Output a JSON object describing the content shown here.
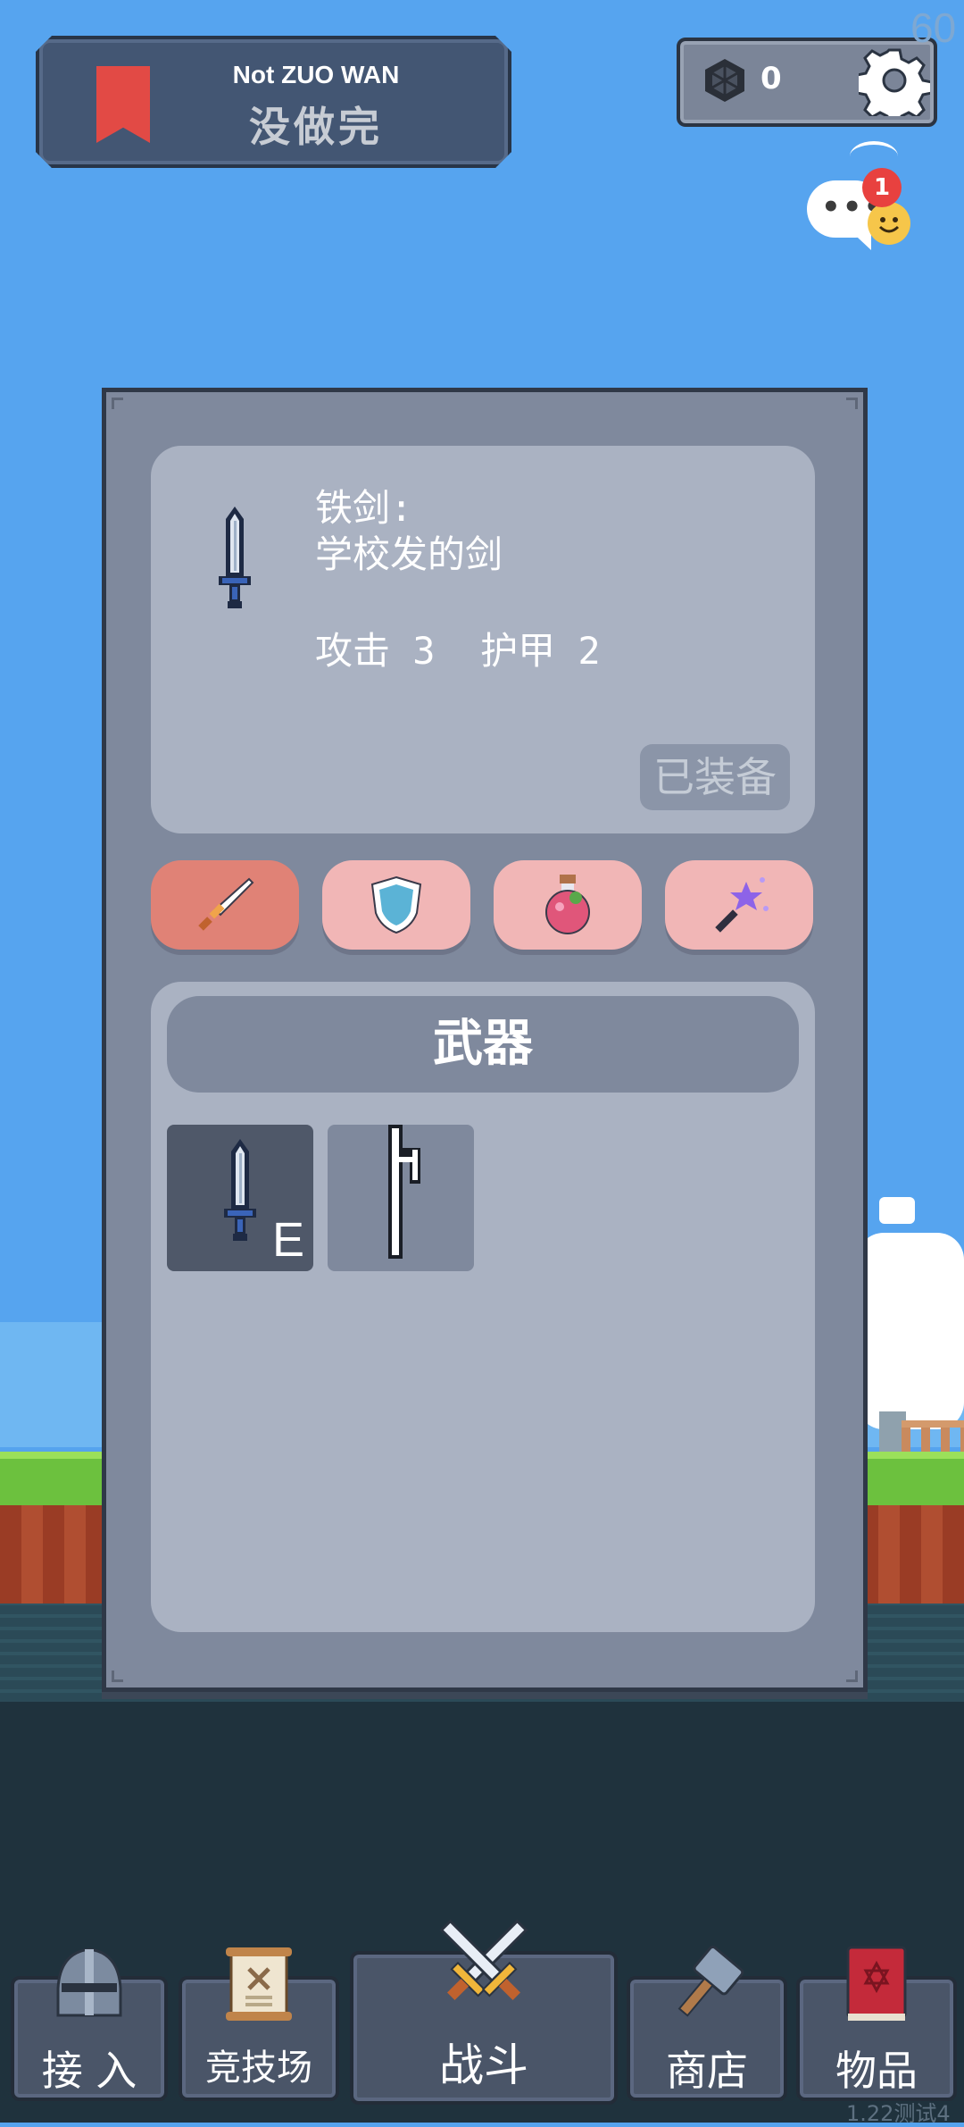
{
  "app": {
    "fps": "60",
    "version": "1.22测试4"
  },
  "header": {
    "title_en": "Not ZUO WAN",
    "title_cn": "没做完",
    "gems": "0",
    "chat_badge": "1"
  },
  "item_detail": {
    "name": "铁剑:",
    "description": "学校发的剑",
    "stats": "攻击 3  护甲 2",
    "equipped_label": "已装备"
  },
  "categories": [
    {
      "id": "weapon",
      "icon": "sword-icon",
      "color": "#e08276"
    },
    {
      "id": "armor",
      "icon": "shield-icon",
      "color": "#f1b6b6"
    },
    {
      "id": "potion",
      "icon": "potion-icon",
      "color": "#f1b6b6"
    },
    {
      "id": "magic",
      "icon": "magic-wand-icon",
      "color": "#f1b6b6"
    }
  ],
  "inventory": {
    "header": "武器",
    "slots": [
      {
        "item": "iron-sword-icon",
        "badge": "E",
        "selected": true
      },
      {
        "item": "stick-icon",
        "badge": "",
        "selected": false
      }
    ]
  },
  "nav": {
    "items": [
      {
        "label": "接 入",
        "icon": "knight-helmet-icon"
      },
      {
        "label": "竞技场",
        "icon": "scroll-icon"
      },
      {
        "label": "战斗",
        "icon": "crossed-swords-icon"
      },
      {
        "label": "商店",
        "icon": "hammer-icon"
      },
      {
        "label": "物品",
        "icon": "spellbook-icon"
      }
    ]
  }
}
